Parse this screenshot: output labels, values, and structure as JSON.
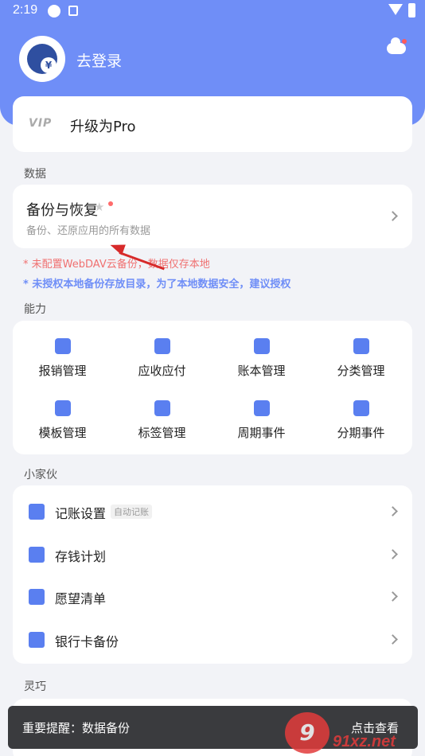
{
  "status_bar": {
    "time": "2:19"
  },
  "header": {
    "login_label": "去登录"
  },
  "pro_card": {
    "vip_text": "VIP",
    "label": "升级为Pro"
  },
  "sections": {
    "data": "数据",
    "ability": "能力",
    "tools": "小家伙",
    "lingqiao": "灵巧"
  },
  "backup_card": {
    "title": "备份与恢复",
    "subtitle": "备份、还原应用的所有数据"
  },
  "warnings": {
    "webdav": "* 未配置WebDAV云备份，数据仅存本地",
    "authorize": "* 未授权本地备份存放目录，为了本地数据安全，建议授权"
  },
  "abilities": [
    {
      "label": "报销管理",
      "icon": "reimburse-icon"
    },
    {
      "label": "应收应付",
      "icon": "layers-icon"
    },
    {
      "label": "账本管理",
      "icon": "book-icon"
    },
    {
      "label": "分类管理",
      "icon": "category-icon"
    },
    {
      "label": "模板管理",
      "icon": "template-icon"
    },
    {
      "label": "标签管理",
      "icon": "tag-icon"
    },
    {
      "label": "周期事件",
      "icon": "cycle-icon"
    },
    {
      "label": "分期事件",
      "icon": "installment-icon"
    }
  ],
  "tools": [
    {
      "label": "记账设置",
      "badge": "自动记账",
      "icon": "wrench-icon"
    },
    {
      "label": "存钱计划",
      "icon": "flag-icon"
    },
    {
      "label": "愿望清单",
      "icon": "star-icon"
    },
    {
      "label": "银行卡备份",
      "icon": "card-icon"
    }
  ],
  "toast": {
    "message": "重要提醒：数据备份",
    "action": "点击查看"
  },
  "watermark": {
    "text": "91xz.net",
    "logo": "9"
  },
  "colors": {
    "accent": "#6f8ef7",
    "warning_red": "#f07070"
  }
}
